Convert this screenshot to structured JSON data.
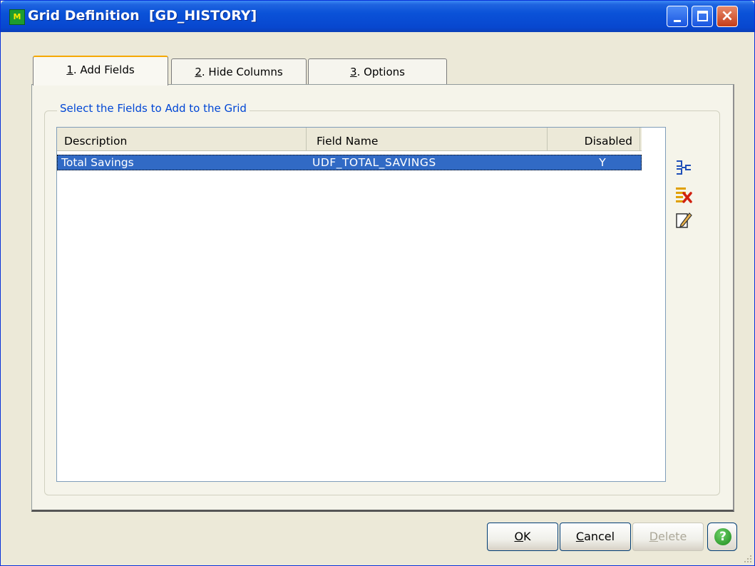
{
  "window": {
    "app_icon_text": "M",
    "title": "Grid Definition  [GD_HISTORY]"
  },
  "tabs": [
    {
      "hotkey": "1",
      "rest": ". Add Fields"
    },
    {
      "hotkey": "2",
      "rest": ". Hide Columns"
    },
    {
      "hotkey": "3",
      "rest": ". Options"
    }
  ],
  "group": {
    "label": "Select the Fields to Add to the Grid"
  },
  "grid": {
    "columns": [
      "Description",
      "Field Name",
      "Disabled"
    ],
    "rows": [
      {
        "description": "Total Savings",
        "field_name": "UDF_TOTAL_SAVINGS",
        "disabled": "Y"
      }
    ]
  },
  "side_icons": [
    "add-fields-icon",
    "delete-fields-icon",
    "edit-field-icon"
  ],
  "buttons": {
    "ok_hotkey": "O",
    "ok_rest": "K",
    "cancel_hotkey": "C",
    "cancel_rest": "ancel",
    "delete_hotkey": "D",
    "delete_rest": "elete",
    "help_glyph": "?"
  },
  "colors": {
    "selection": "#316ac5",
    "group_label": "#0046d5",
    "title_bar": "#0a52d8"
  }
}
